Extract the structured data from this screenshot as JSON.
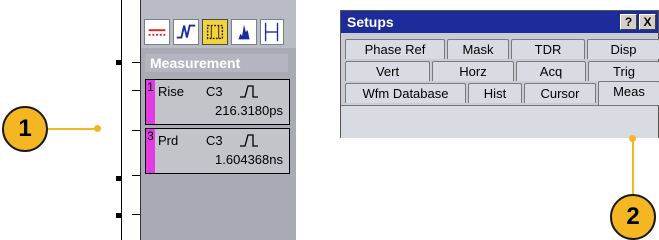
{
  "measurement_panel": {
    "title": "Measurement",
    "items": [
      {
        "number": "1",
        "name": "Rise",
        "source": "C3",
        "value": "216.3180ps"
      },
      {
        "number": "3",
        "name": "Prd",
        "source": "C3",
        "value": "1.604368ns"
      }
    ]
  },
  "toolbar": {
    "icons": [
      "trigger-level-icon",
      "waveform-icon",
      "measurement-icon",
      "histogram-icon",
      "cursor-icon"
    ],
    "selected": "measurement-icon"
  },
  "setups_dialog": {
    "title": "Setups",
    "help_button": "?",
    "close_button": "X",
    "tabs_row1": [
      "Phase Ref",
      "Mask",
      "TDR",
      "Disp"
    ],
    "tabs_row2": [
      "Vert",
      "Horz",
      "Acq",
      "Trig"
    ],
    "tabs_row3": [
      "Wfm Database",
      "Hist",
      "Cursor",
      "Meas"
    ],
    "active_tab": "Meas"
  },
  "callouts": {
    "left": "1",
    "right": "2"
  },
  "colors": {
    "callout": "#f5b624",
    "title_bar": "#1d2c9b",
    "channel_marker": "#e23be3",
    "selected_icon": "#f2d33c"
  }
}
